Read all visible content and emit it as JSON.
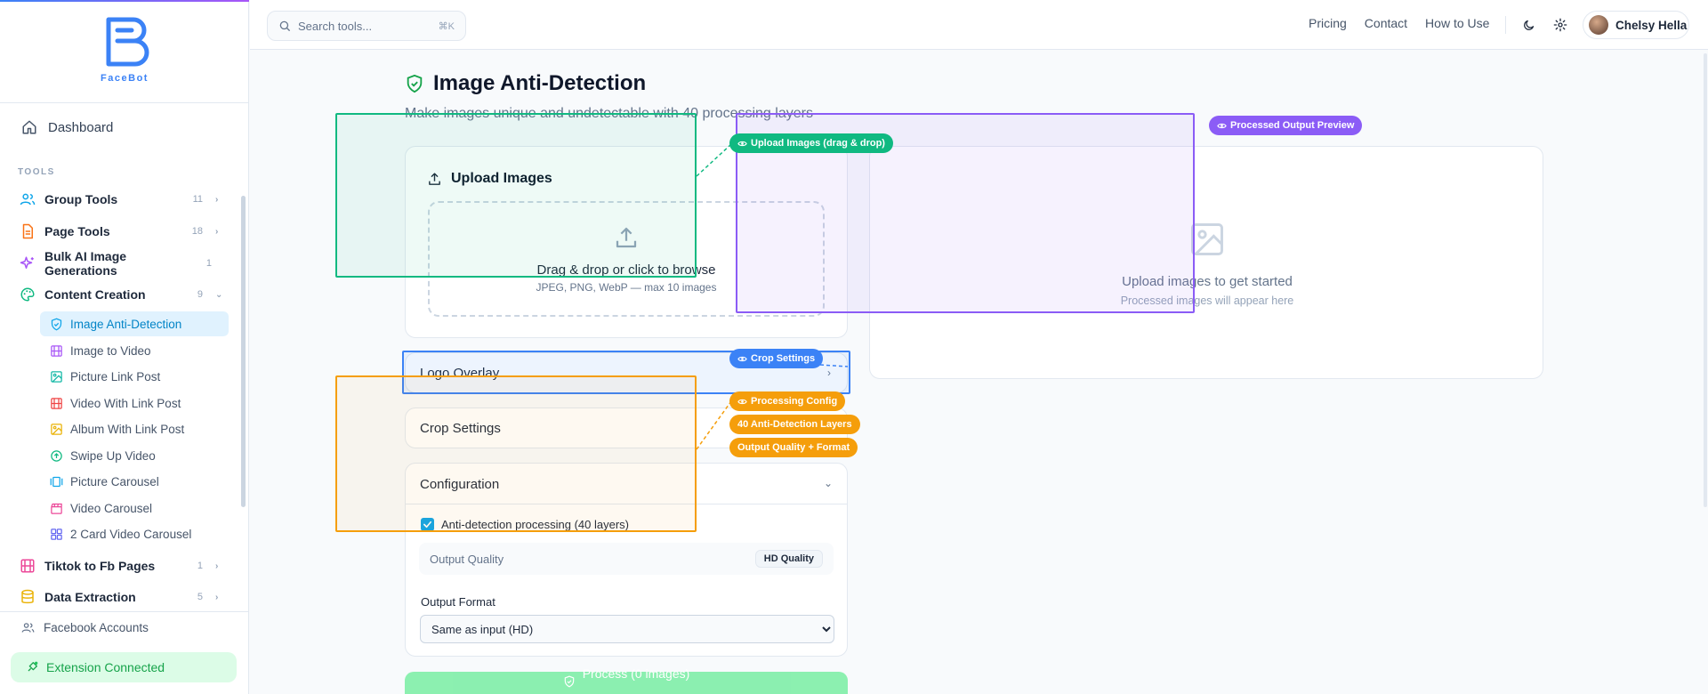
{
  "brand": {
    "name": "FaceBot",
    "accent": "#3b82f6"
  },
  "sidebar": {
    "dashboard": "Dashboard",
    "section_label": "TOOLS",
    "items": [
      {
        "label": "Group Tools",
        "count": "11",
        "icon": "users-icon",
        "color": "#0ea5e9"
      },
      {
        "label": "Page Tools",
        "count": "18",
        "icon": "file-icon",
        "color": "#f97316"
      },
      {
        "label": "Bulk AI Image Generations",
        "count": "1",
        "icon": "sparkles-icon",
        "color": "#a855f7"
      },
      {
        "label": "Content Creation",
        "count": "9",
        "icon": "palette-icon",
        "color": "#10b981"
      },
      {
        "label": "Tiktok to Fb Pages",
        "count": "1",
        "icon": "film-icon",
        "color": "#ec4899"
      },
      {
        "label": "Data Extraction",
        "count": "5",
        "icon": "database-icon",
        "color": "#eab308"
      }
    ],
    "sub_items": [
      {
        "label": "Image Anti-Detection",
        "icon": "shield-check-icon",
        "color": "#0ea5e9"
      },
      {
        "label": "Image to Video",
        "icon": "film-icon",
        "color": "#a855f7"
      },
      {
        "label": "Picture Link Post",
        "icon": "image-icon",
        "color": "#14b8a6"
      },
      {
        "label": "Video With Link Post",
        "icon": "film-icon",
        "color": "#ef4444"
      },
      {
        "label": "Album With Link Post",
        "icon": "images-icon",
        "color": "#eab308"
      },
      {
        "label": "Swipe Up Video",
        "icon": "arrow-up-circle-icon",
        "color": "#10b981"
      },
      {
        "label": "Picture Carousel",
        "icon": "carousel-icon",
        "color": "#0ea5e9"
      },
      {
        "label": "Video Carousel",
        "icon": "clapperboard-icon",
        "color": "#ec4899"
      },
      {
        "label": "2 Card Video Carousel",
        "icon": "grid-icon",
        "color": "#6366f1"
      }
    ],
    "facebook_accounts": "Facebook Accounts",
    "extension_status": "Extension Connected"
  },
  "header": {
    "search_placeholder": "Search tools...",
    "search_shortcut": "⌘K",
    "links": [
      "Pricing",
      "Contact",
      "How to Use"
    ],
    "user_name": "Chelsy Hella"
  },
  "main": {
    "title": "Image Anti-Detection",
    "subtitle": "Make images unique and undetectable with 40 processing layers",
    "upload": {
      "title": "Upload Images",
      "drop_main": "Drag & drop or click to browse",
      "drop_sub": "JPEG, PNG, WebP — max 10 images"
    },
    "preview": {
      "main": "Upload images to get started",
      "sub": "Processed images will appear here"
    },
    "logo_overlay": "Logo Overlay",
    "crop_settings": "Crop Settings",
    "configuration": {
      "title": "Configuration",
      "anti_detection_label": "Anti-detection processing (40 layers)",
      "anti_detection_checked": true,
      "output_quality_label": "Output Quality",
      "output_quality_value": "HD Quality",
      "output_format_label": "Output Format",
      "output_format_value": "Same as input (HD)"
    },
    "process_button": "Process (0 images)"
  },
  "annotations": {
    "upload": "Upload Images (drag & drop)",
    "preview": "Processed Output Preview",
    "crop": "Crop Settings",
    "processing": "Processing Config",
    "layers": "40 Anti-Detection Layers",
    "quality": "Output Quality + Format"
  }
}
